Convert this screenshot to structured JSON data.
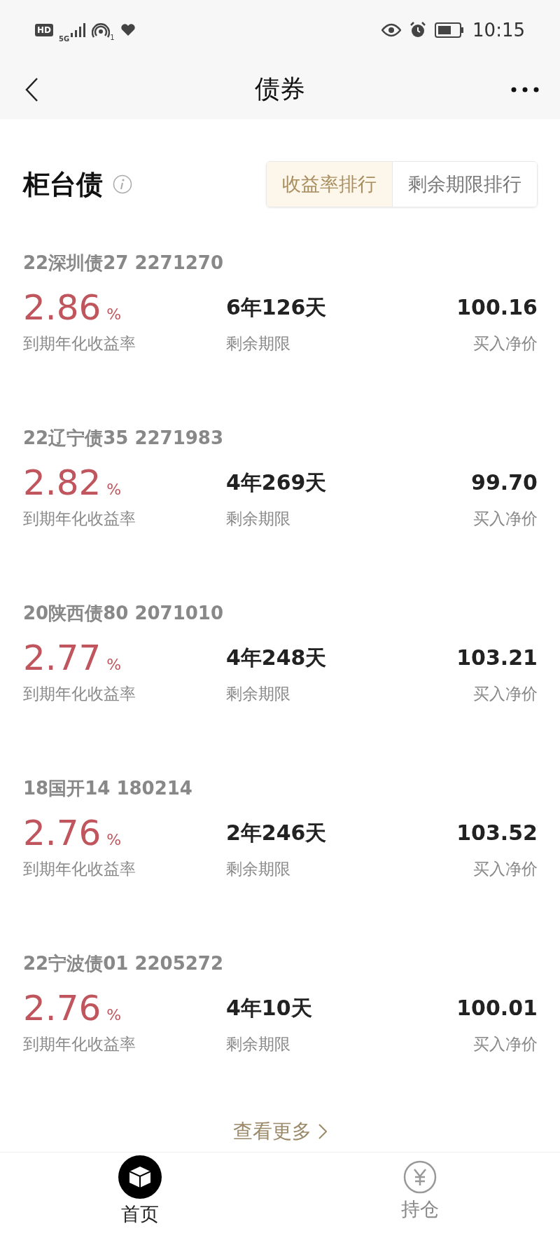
{
  "status_bar": {
    "hd": "HD",
    "network": "5G",
    "hotspot_count": "1",
    "time": "10:15"
  },
  "header": {
    "title": "债券"
  },
  "section": {
    "title": "柜台债",
    "tabs": [
      {
        "label": "收益率排行",
        "selected": true
      },
      {
        "label": "剩余期限排行",
        "selected": false
      }
    ]
  },
  "bonds": [
    {
      "name": "22深圳债27 2271270",
      "yield": "2.86",
      "yield_unit": "%",
      "yield_label": "到期年化收益率",
      "term": "6年126天",
      "term_label": "剩余期限",
      "price": "100.16",
      "price_label": "买入净价"
    },
    {
      "name": "22辽宁债35 2271983",
      "yield": "2.82",
      "yield_unit": "%",
      "yield_label": "到期年化收益率",
      "term": "4年269天",
      "term_label": "剩余期限",
      "price": "99.70",
      "price_label": "买入净价"
    },
    {
      "name": "20陕西债80 2071010",
      "yield": "2.77",
      "yield_unit": "%",
      "yield_label": "到期年化收益率",
      "term": "4年248天",
      "term_label": "剩余期限",
      "price": "103.21",
      "price_label": "买入净价"
    },
    {
      "name": "18国开14 180214",
      "yield": "2.76",
      "yield_unit": "%",
      "yield_label": "到期年化收益率",
      "term": "2年246天",
      "term_label": "剩余期限",
      "price": "103.52",
      "price_label": "买入净价"
    },
    {
      "name": "22宁波债01 2205272",
      "yield": "2.76",
      "yield_unit": "%",
      "yield_label": "到期年化收益率",
      "term": "4年10天",
      "term_label": "剩余期限",
      "price": "100.01",
      "price_label": "买入净价"
    }
  ],
  "more_link": "查看更多",
  "nav": [
    {
      "label": "首页",
      "selected": true,
      "kind": "home"
    },
    {
      "label": "持仓",
      "selected": false,
      "kind": "holdings"
    }
  ]
}
